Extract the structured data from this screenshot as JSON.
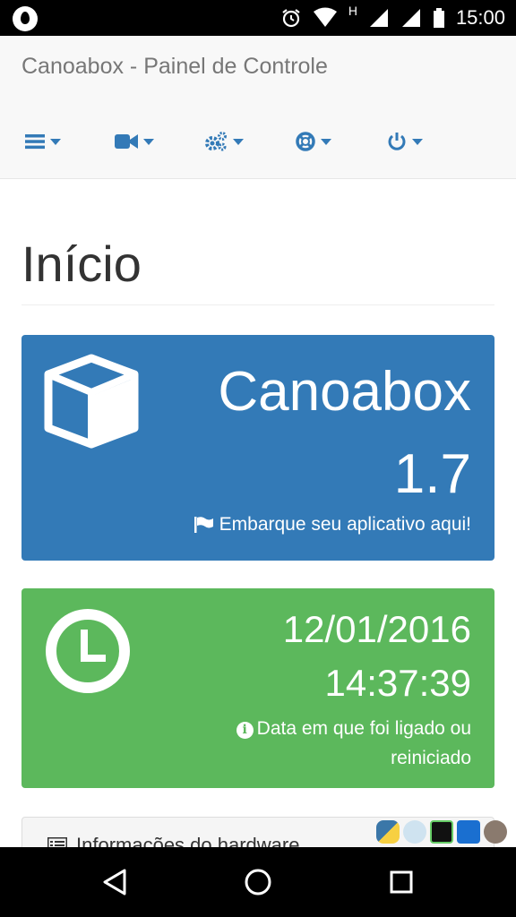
{
  "status_bar": {
    "time": "15:00",
    "icons": [
      "drop-icon",
      "alarm-icon",
      "wifi-icon",
      "signal-h-icon",
      "signal-icon",
      "battery-icon"
    ],
    "network_label": "H"
  },
  "navbar": {
    "brand": "Canoabox - Painel de Controle",
    "menu": [
      {
        "name": "menu-list",
        "icon": "list-icon"
      },
      {
        "name": "menu-video",
        "icon": "video-camera-icon"
      },
      {
        "name": "menu-settings",
        "icon": "gears-icon"
      },
      {
        "name": "menu-help",
        "icon": "life-ring-icon"
      },
      {
        "name": "menu-power",
        "icon": "power-icon"
      }
    ],
    "accent_color": "#337ab7"
  },
  "page": {
    "title": "Início"
  },
  "app_panel": {
    "name": "Canoabox",
    "version": "1.7",
    "note": "Embarque seu aplicativo aqui!",
    "icon": "cube-icon",
    "note_icon": "flag-icon",
    "color": "#337ab7"
  },
  "uptime_panel": {
    "date": "12/01/2016",
    "time": "14:37:39",
    "note": "Data em que foi ligado ou reiniciado",
    "icon": "clock-icon",
    "note_icon": "info-icon",
    "color": "#5cb85c"
  },
  "hardware_panel": {
    "title": "Informações do hardware",
    "icon": "list-alt-icon"
  },
  "system_tray": [
    "python-icon",
    "app-icon",
    "vnc-icon",
    "home-icon",
    "avatar"
  ],
  "android_nav": [
    "back-icon",
    "home-circle-icon",
    "recents-icon"
  ]
}
